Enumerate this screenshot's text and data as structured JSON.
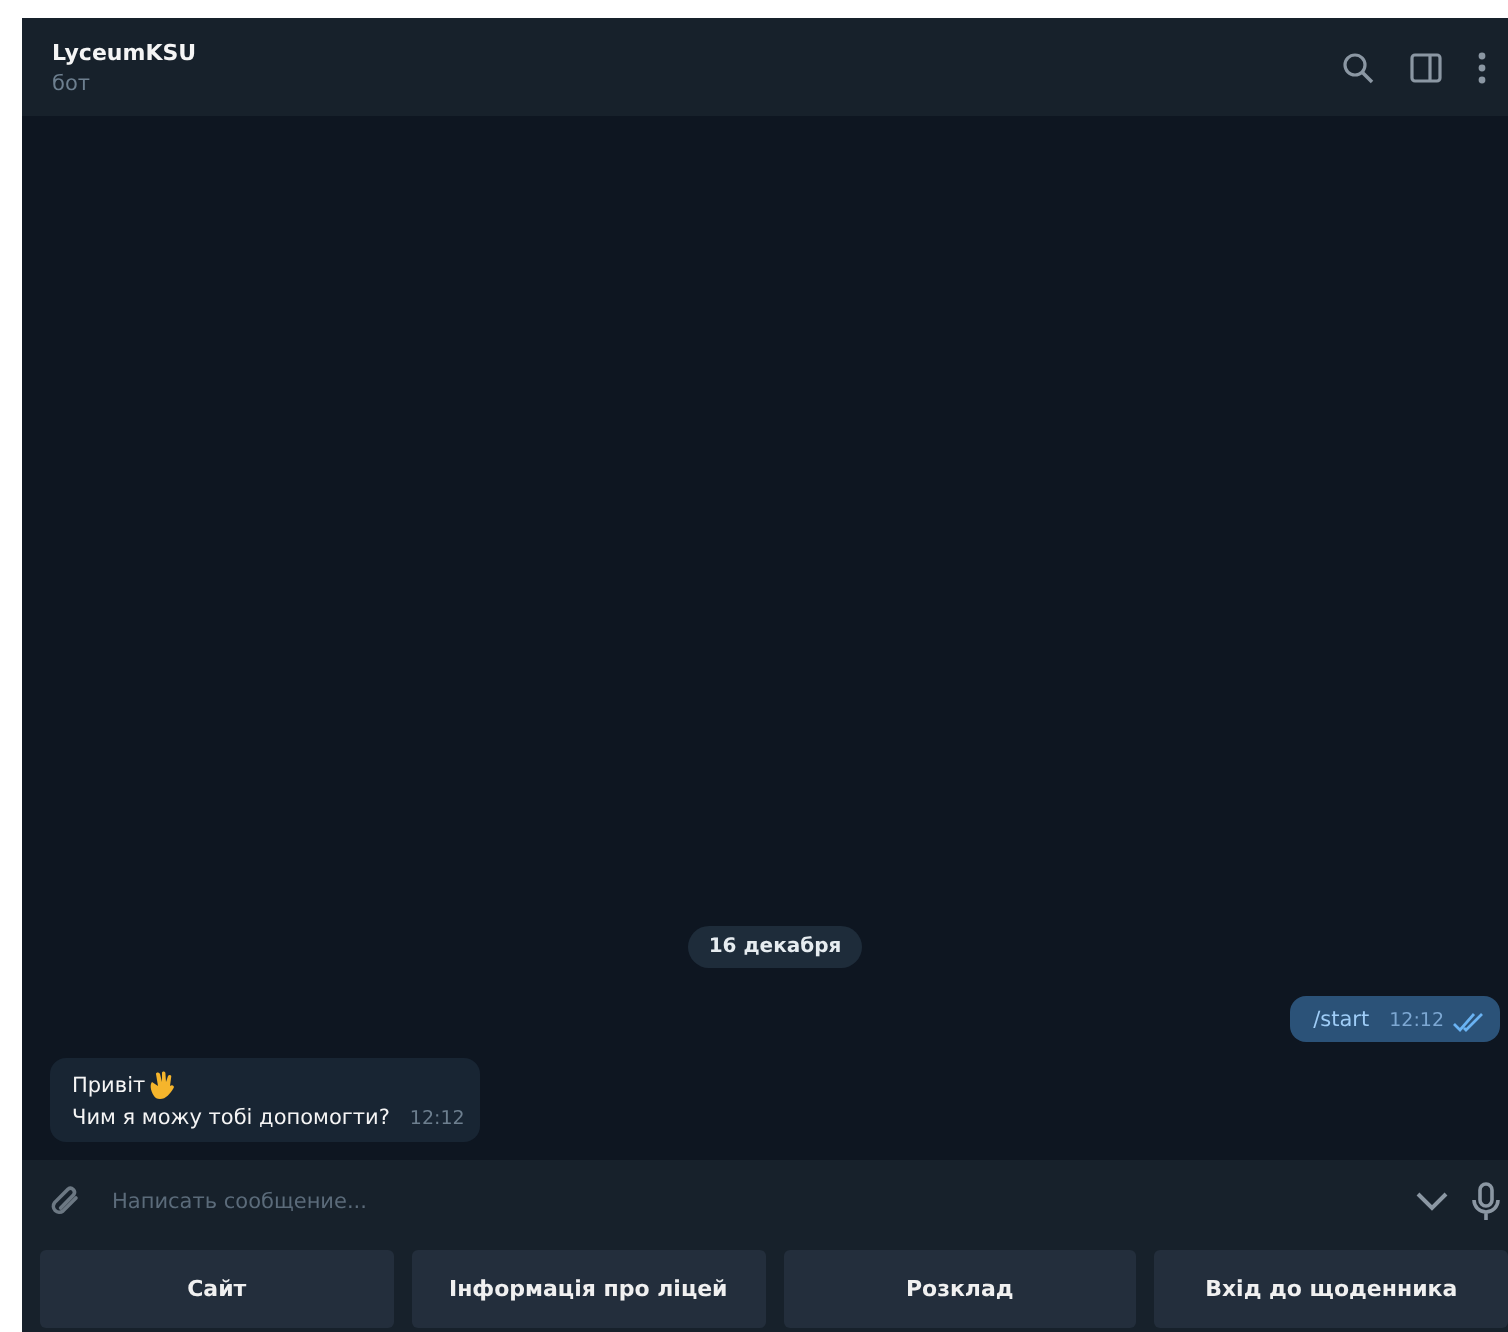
{
  "header": {
    "title": "LyceumKSU",
    "subtitle": "бот"
  },
  "date_badge": "16 декабря",
  "messages": [
    {
      "kind": "outgoing",
      "lines": [
        "/start"
      ],
      "time": "12:12",
      "read": true
    },
    {
      "kind": "incoming",
      "lines": [
        "Привіт",
        "Чим я можу тобі допомогти?"
      ],
      "wave": true,
      "time": "12:12"
    }
  ],
  "composer": {
    "placeholder": "Написать сообщение..."
  },
  "keyboard": [
    "Сайт",
    "Інформація про ліцей",
    "Розклад",
    "Вхід до щоденника"
  ]
}
